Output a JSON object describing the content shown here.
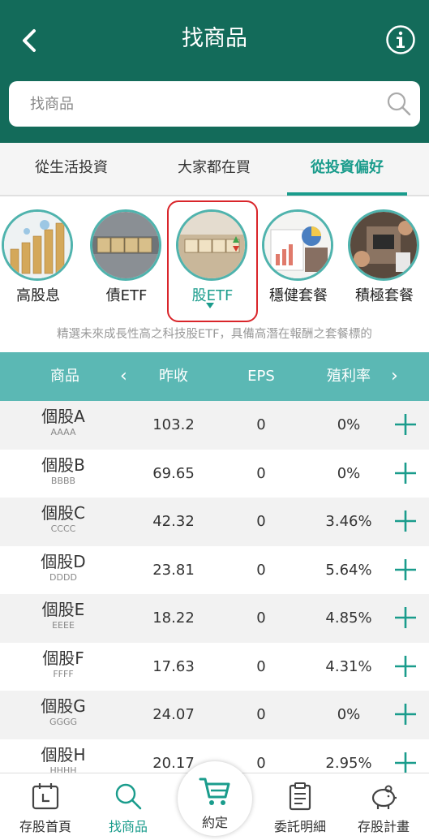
{
  "header": {
    "title": "找商品",
    "back_icon": "chevron-left-icon",
    "info_icon": "info-icon"
  },
  "search": {
    "placeholder": "找商品",
    "icon": "search-icon"
  },
  "tabs": [
    {
      "label": "從生活投資",
      "active": false
    },
    {
      "label": "大家都在買",
      "active": false
    },
    {
      "label": "從投資偏好",
      "active": true
    }
  ],
  "categories": [
    {
      "label": "高股息",
      "selected": false
    },
    {
      "label": "債ETF",
      "selected": false
    },
    {
      "label": "股ETF",
      "selected": true
    },
    {
      "label": "穩健套餐",
      "selected": false
    },
    {
      "label": "積極套餐",
      "selected": false
    }
  ],
  "category_description": "精選未來成長性高之科技股ETF，具備高潛在報酬之套餐標的",
  "table": {
    "headers": {
      "name": "商品",
      "prev_close": "昨收",
      "eps": "EPS",
      "yield": "殖利率"
    },
    "rows": [
      {
        "name": "個股A",
        "code": "AAAA",
        "prev_close": "103.2",
        "eps": "0",
        "yield": "0%"
      },
      {
        "name": "個股B",
        "code": "BBBB",
        "prev_close": "69.65",
        "eps": "0",
        "yield": "0%"
      },
      {
        "name": "個股C",
        "code": "CCCC",
        "prev_close": "42.32",
        "eps": "0",
        "yield": "3.46%"
      },
      {
        "name": "個股D",
        "code": "DDDD",
        "prev_close": "23.81",
        "eps": "0",
        "yield": "5.64%"
      },
      {
        "name": "個股E",
        "code": "EEEE",
        "prev_close": "18.22",
        "eps": "0",
        "yield": "4.85%"
      },
      {
        "name": "個股F",
        "code": "FFFF",
        "prev_close": "17.63",
        "eps": "0",
        "yield": "4.31%"
      },
      {
        "name": "個股G",
        "code": "GGGG",
        "prev_close": "24.07",
        "eps": "0",
        "yield": "0%"
      },
      {
        "name": "個股H",
        "code": "HHHH",
        "prev_close": "20.17",
        "eps": "0",
        "yield": "2.95%"
      }
    ]
  },
  "bottom_nav": [
    {
      "label": "存股首頁",
      "icon": "calendar-icon",
      "active": false
    },
    {
      "label": "找商品",
      "icon": "search-icon",
      "active": true
    },
    {
      "label": "約定",
      "icon": "cart-icon",
      "active": false
    },
    {
      "label": "委託明細",
      "icon": "clipboard-icon",
      "active": false
    },
    {
      "label": "存股計畫",
      "icon": "piggy-bank-icon",
      "active": false
    }
  ],
  "colors": {
    "header": "#136b5a",
    "accent": "#1a9c8c",
    "table_header": "#5bb8b4",
    "selection_border": "#d9252a"
  }
}
